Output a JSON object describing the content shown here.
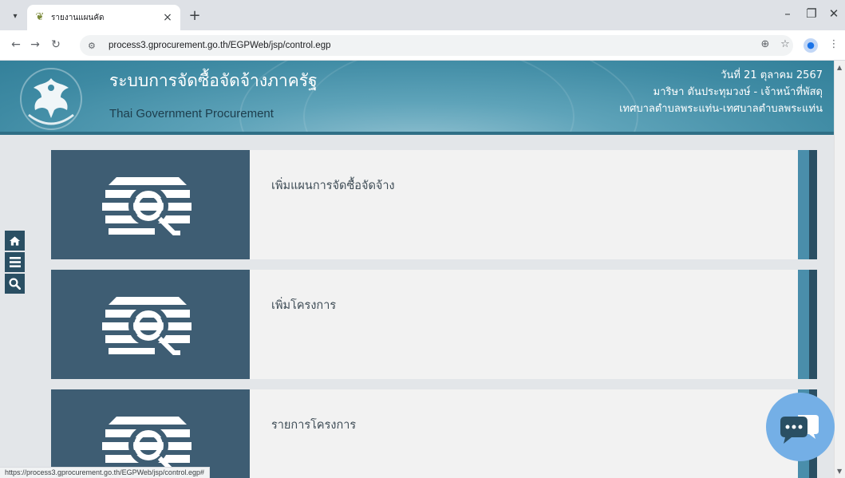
{
  "browser": {
    "tab_title": "รายงานแผนคัด",
    "tab_close": "×",
    "new_tab": "+",
    "url": "process3.gprocurement.go.th/EGPWeb/jsp/control.egp",
    "status_url": "https://process3.gprocurement.go.th/EGPWeb/jsp/control.egp#",
    "controls": {
      "minimize": "–",
      "restore": "❐",
      "close": "✕"
    }
  },
  "header": {
    "title": "ระบบการจัดซื้อจัดจ้างภาครัฐ",
    "subtitle": "Thai Government Procurement",
    "date": "วันที่ 21 ตุลาคม 2567",
    "user": "มาริษา ตันประทุมวงษ์ - เจ้าหน้าที่พัสดุ",
    "org": "เทศบาลตำบลพระแท่น-เทศบาลตำบลพระแท่น"
  },
  "sidebar": {
    "icons": [
      "home-icon",
      "menu-icon",
      "search-icon"
    ]
  },
  "cards": [
    {
      "label": "เพิ่มแผนการจัดซื้อจัดจ้าง",
      "icon": "procurement-search-icon"
    },
    {
      "label": "เพิ่มโครงการ",
      "icon": "procurement-search-icon"
    },
    {
      "label": "รายการโครงการ",
      "icon": "procurement-search-icon"
    }
  ],
  "colors": {
    "card_image_bg": "#3e5d73",
    "card_bg": "#f2f2f2",
    "accent_bar": "#4a8eab",
    "banner": "#3e8aa3",
    "chat_bubble": "#74afe6"
  }
}
